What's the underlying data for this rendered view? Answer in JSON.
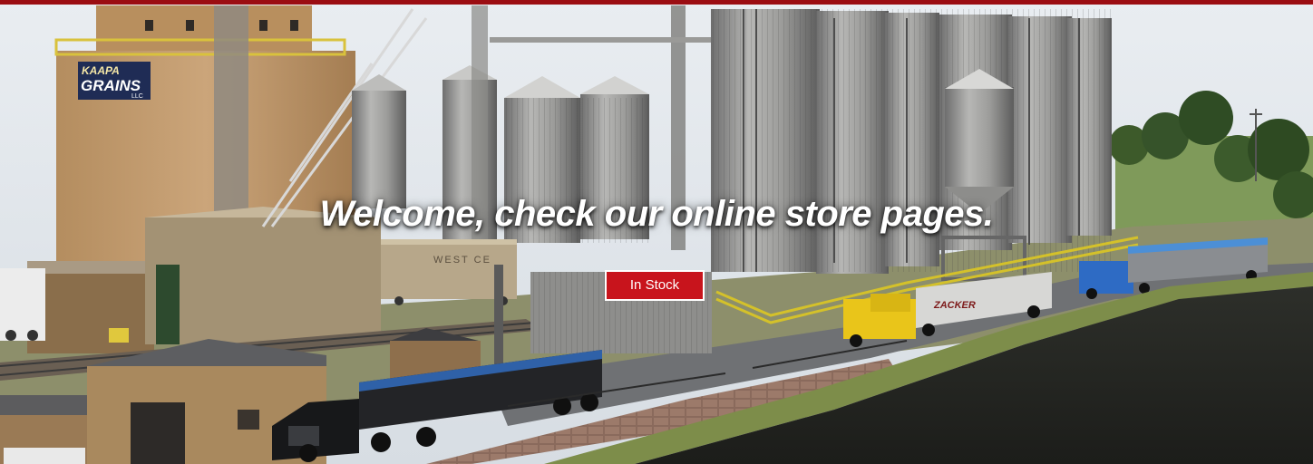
{
  "hero": {
    "headline": "Welcome, check our online store pages.",
    "cta_label": "In Stock",
    "elevator_sign_line1": "KAAPA",
    "elevator_sign_line2": "GRAINS",
    "elevator_sign_line3": "LLC",
    "boxcar_lettering": "WEST CE",
    "truck_trailer_lettering": "ZACKER"
  },
  "colors": {
    "top_rule": "#9b0d12",
    "cta_background": "#c8141c",
    "cta_text": "#ffffff",
    "headline_text": "#ffffff"
  }
}
